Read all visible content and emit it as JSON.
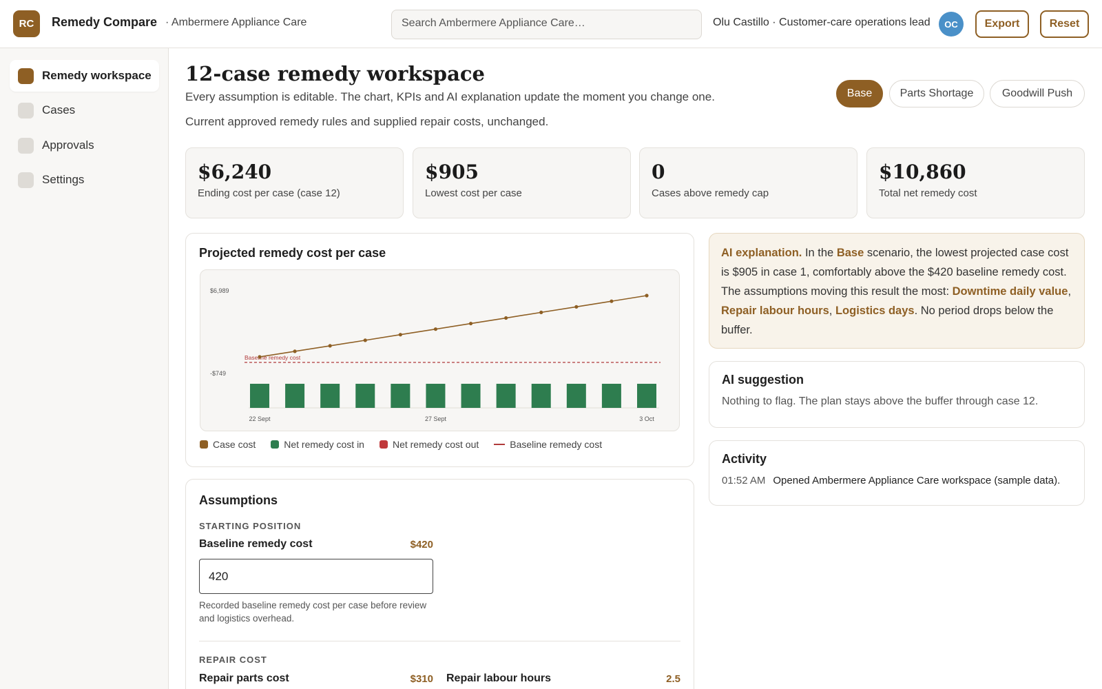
{
  "header": {
    "logo_initials": "RC",
    "app_title": "Remedy Compare",
    "org_name": "· Ambermere Appliance Care",
    "search_placeholder": "Search Ambermere Appliance Care…",
    "user_info": "Olu Castillo · Customer-care operations lead",
    "user_initials": "OC",
    "export_label": "Export",
    "reset_label": "Reset"
  },
  "sidebar": {
    "items": [
      {
        "label": "Remedy workspace",
        "active": true
      },
      {
        "label": "Cases",
        "active": false
      },
      {
        "label": "Approvals",
        "active": false
      },
      {
        "label": "Settings",
        "active": false
      }
    ]
  },
  "page": {
    "title": "12-case remedy workspace",
    "description": "Every assumption is editable. The chart, KPIs and AI explanation update the moment you change one.",
    "scenario_description": "Current approved remedy rules and supplied repair costs, unchanged."
  },
  "scenarios": [
    {
      "label": "Base",
      "active": true
    },
    {
      "label": "Parts Shortage",
      "active": false
    },
    {
      "label": "Goodwill Push",
      "active": false
    }
  ],
  "kpis": [
    {
      "value": "$6,240",
      "label": "Ending cost per case (case 12)"
    },
    {
      "value": "$905",
      "label": "Lowest cost per case"
    },
    {
      "value": "0",
      "label": "Cases above remedy cap"
    },
    {
      "value": "$10,860",
      "label": "Total net remedy cost"
    }
  ],
  "chart": {
    "title": "Projected remedy cost per case",
    "legend": {
      "case_cost": "Case cost",
      "net_in": "Net remedy cost in",
      "net_out": "Net remedy cost out",
      "baseline": "Baseline remedy cost"
    },
    "baseline_label": "Baseline remedy cost"
  },
  "chart_data": {
    "type": "line",
    "x_labels": [
      "22 Sept",
      "27 Sept",
      "3 Oct"
    ],
    "y_tick_labels": [
      "$6,989",
      "-$749"
    ],
    "ylim": [
      -749,
      6989
    ],
    "line_series": {
      "name": "Case cost",
      "values": [
        905,
        1390,
        1870,
        2350,
        2840,
        3320,
        3810,
        4290,
        4780,
        5260,
        5750,
        6240
      ]
    },
    "bar_series": {
      "name": "Net remedy cost in",
      "values": [
        905,
        905,
        905,
        905,
        905,
        905,
        905,
        905,
        905,
        905,
        905,
        905
      ]
    },
    "baseline": {
      "name": "Baseline remedy cost",
      "value": 420
    },
    "colors": {
      "line": "#8e5f24",
      "bars": "#2e7d4f",
      "out": "#c0393b",
      "baseline": "#b03a3a"
    },
    "grid": false,
    "legend_placement": "bottom-left"
  },
  "ai": {
    "explanation": {
      "lead": "AI explanation.",
      "t1": " In the ",
      "scenario": "Base",
      "t2": " scenario, the lowest projected case cost is $905 in case 1, comfortably above the $420 baseline remedy cost. The assumptions moving this result the most: ",
      "f1": "Downtime daily value",
      "sep1": ", ",
      "f2": "Repair labour hours",
      "sep2": ", ",
      "f3": "Logistics days",
      "t3": ". No period drops below the buffer."
    },
    "suggestion_title": "AI suggestion",
    "suggestion_text": "Nothing to flag. The plan stays above the buffer through case 12."
  },
  "activity": {
    "title": "Activity",
    "entries": [
      {
        "time": "01:52 AM",
        "text": "Opened Ambermere Appliance Care workspace (sample data)."
      }
    ]
  },
  "assumptions": {
    "title": "Assumptions",
    "starting_section": "STARTING POSITION",
    "baseline_label": "Baseline remedy cost",
    "baseline_display": "$420",
    "baseline_input": "420",
    "baseline_help": "Recorded baseline remedy cost per case before review and logistics overhead.",
    "repair_section": "REPAIR COST",
    "repair_parts_label": "Repair parts cost",
    "repair_parts_display": "$310",
    "repair_labour_label": "Repair labour hours",
    "repair_labour_display": "2.5"
  }
}
